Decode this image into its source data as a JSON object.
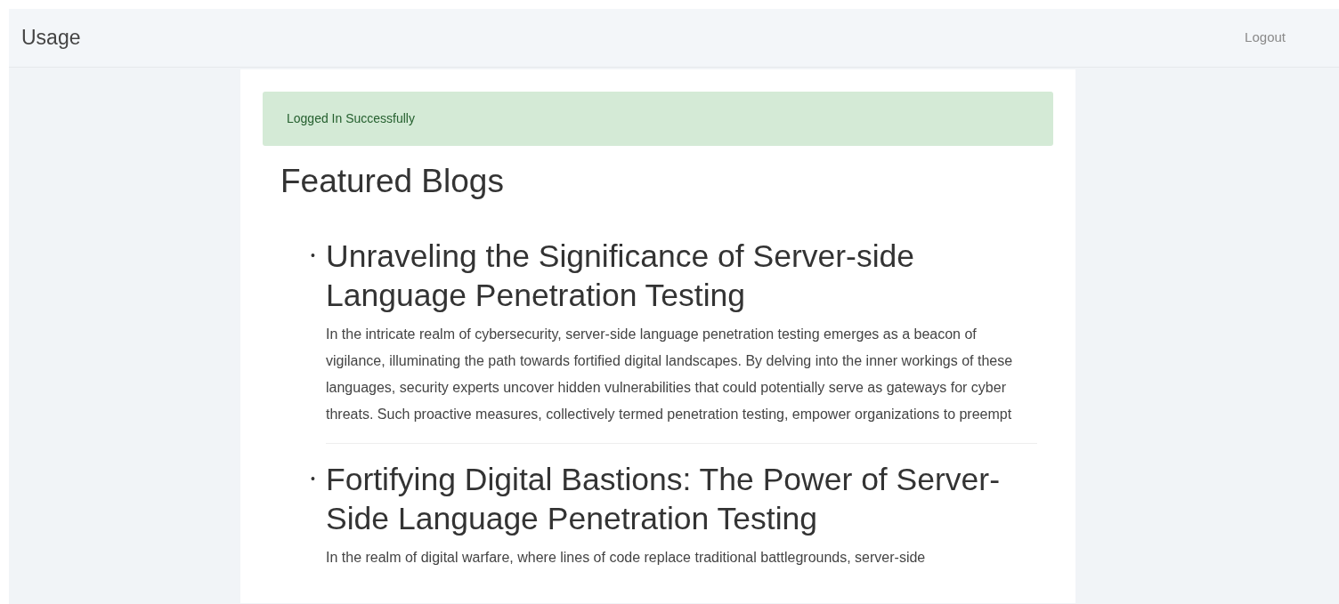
{
  "navbar": {
    "brand": "Usage",
    "links": [
      "Logout"
    ]
  },
  "alert": {
    "kind": "success",
    "text": "Logged In Successfully"
  },
  "heading": "Featured Blogs",
  "blogs": [
    {
      "bullet": "•",
      "title": "Unraveling the Significance of Server-side Language Penetration Testing",
      "excerpt": "In the intricate realm of cybersecurity, server-side language penetration testing emerges as a beacon of vigilance, illuminating the path towards fortified digital landscapes. By delving into the inner workings of these languages, security experts uncover hidden vulnerabilities that could potentially serve as gateways for cyber threats. Such proactive measures, collectively termed penetration testing, empower organizations to preempt"
    },
    {
      "bullet": "•",
      "title": "Fortifying Digital Bastions: The Power of Server-Side Language Penetration Testing",
      "excerpt": "In the realm of digital warfare, where lines of code replace traditional battlegrounds, server-side"
    }
  ]
}
